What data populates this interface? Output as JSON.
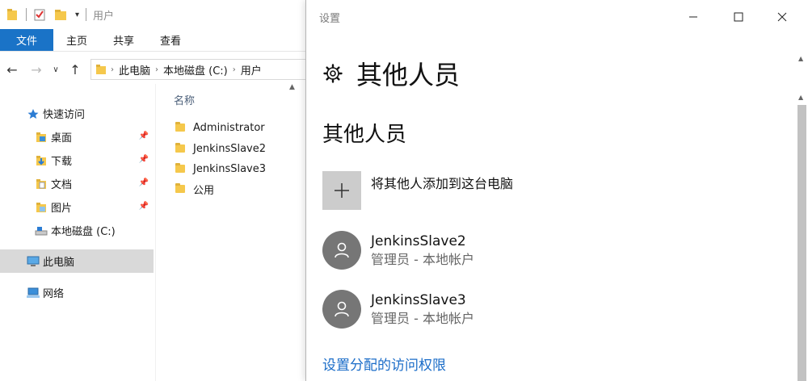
{
  "explorer": {
    "title": "用户",
    "ribbon_tabs": [
      "文件",
      "主页",
      "共享",
      "查看"
    ],
    "address": [
      "此电脑",
      "本地磁盘 (C:)",
      "用户"
    ],
    "nav_items": [
      {
        "label": "快速访问",
        "icon": "star-icon"
      },
      {
        "label": "桌面",
        "icon": "folder-icon",
        "pinned": true
      },
      {
        "label": "下载",
        "icon": "download-folder-icon",
        "pinned": true
      },
      {
        "label": "文档",
        "icon": "document-folder-icon",
        "pinned": true
      },
      {
        "label": "图片",
        "icon": "pictures-folder-icon",
        "pinned": true
      },
      {
        "label": "本地磁盘 (C:)",
        "icon": "drive-icon"
      },
      {
        "label": "此电脑",
        "icon": "computer-icon",
        "selected": true
      },
      {
        "label": "网络",
        "icon": "network-icon"
      }
    ],
    "column_header": "名称",
    "files": [
      "Administrator",
      "JenkinsSlave2",
      "JenkinsSlave3",
      "公用"
    ]
  },
  "settings": {
    "window_title": "设置",
    "page_title": "其他人员",
    "section_title": "其他人员",
    "add_label": "将其他人添加到这台电脑",
    "users": [
      {
        "name": "JenkinsSlave2",
        "role": "管理员 - 本地帐户"
      },
      {
        "name": "JenkinsSlave3",
        "role": "管理员 - 本地帐户"
      }
    ],
    "link": "设置分配的访问权限"
  },
  "colors": {
    "accent": "#1a73c7",
    "link": "#1a6cc8",
    "avatar": "#767676",
    "add_tile": "#cccccc"
  }
}
